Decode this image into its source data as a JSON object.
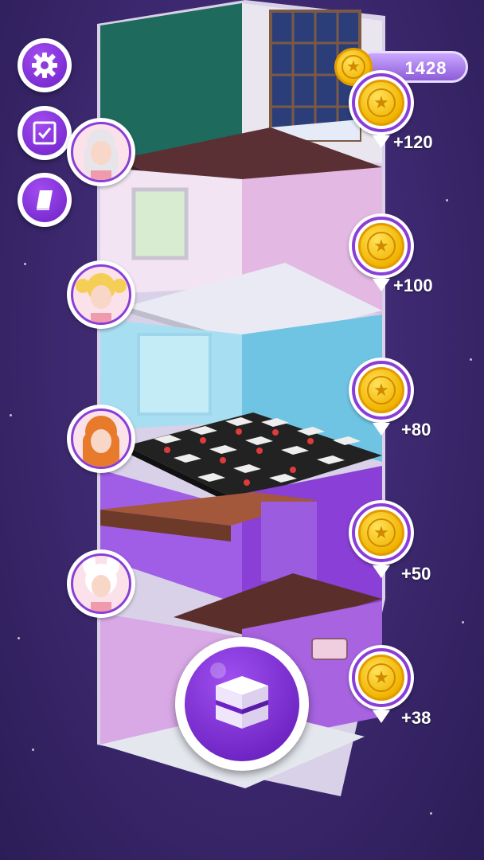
{
  "coins": {
    "total": "1428",
    "icon": "star-coin-icon"
  },
  "menu": {
    "settings_icon": "gear-icon",
    "tasks_icon": "checklist-icon",
    "book_icon": "book-icon"
  },
  "floors": [
    {
      "reward": "+120",
      "avatar": "silver-hair-girl",
      "theme_color": "#1f6f61"
    },
    {
      "reward": "+100",
      "avatar": "blonde-pigtail-girl",
      "theme_color": "#e4c6e6"
    },
    {
      "reward": "+80",
      "avatar": "ginger-hair-girl",
      "theme_color": "#9fdcf0"
    },
    {
      "reward": "+50",
      "avatar": "bunny-hood-girl",
      "theme_color": "#8a3fd6"
    },
    {
      "reward": "+38",
      "avatar": "",
      "theme_color": "#b98ae6"
    }
  ],
  "play_button": {
    "icon": "cake-stack-icon"
  },
  "colors": {
    "accent": "#8a3ed8",
    "coin": "#f1b400",
    "background": "#3f2a72"
  }
}
